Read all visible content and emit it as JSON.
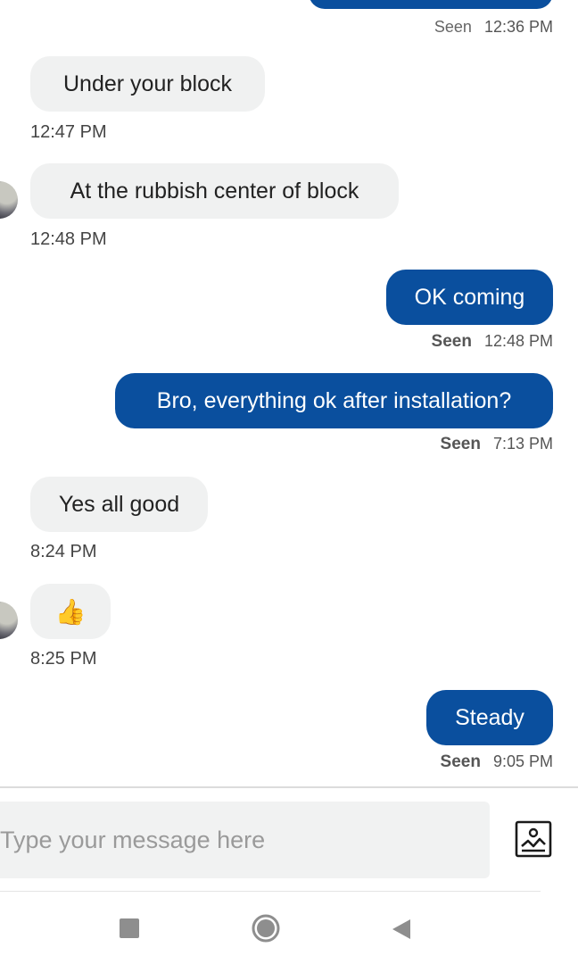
{
  "messages": [
    {
      "direction": "out",
      "text": "",
      "status": "Seen",
      "time": "12:36 PM"
    },
    {
      "direction": "in",
      "text": "Under your block",
      "time": "12:47 PM"
    },
    {
      "direction": "in",
      "text": "At the rubbish center of block",
      "time": "12:48 PM"
    },
    {
      "direction": "out",
      "text": "OK coming",
      "status": "Seen",
      "time": "12:48 PM"
    },
    {
      "direction": "out",
      "text": "Bro, everything ok after installation?",
      "status": "Seen",
      "time": "7:13 PM"
    },
    {
      "direction": "in",
      "text": "Yes all good",
      "time": "8:24 PM"
    },
    {
      "direction": "in",
      "text": "👍",
      "time": "8:25 PM"
    },
    {
      "direction": "out",
      "text": "Steady",
      "status": "Seen",
      "time": "9:05 PM"
    }
  ],
  "composer": {
    "placeholder": "Type your message here",
    "value": ""
  },
  "icons": {
    "attach": "image-attach-icon",
    "nav_recents": "recents-square-icon",
    "nav_home": "home-circle-icon",
    "nav_back": "back-triangle-icon"
  },
  "colors": {
    "outgoing_bubble": "#0a4f9e",
    "incoming_bubble": "#f0f1f1"
  }
}
